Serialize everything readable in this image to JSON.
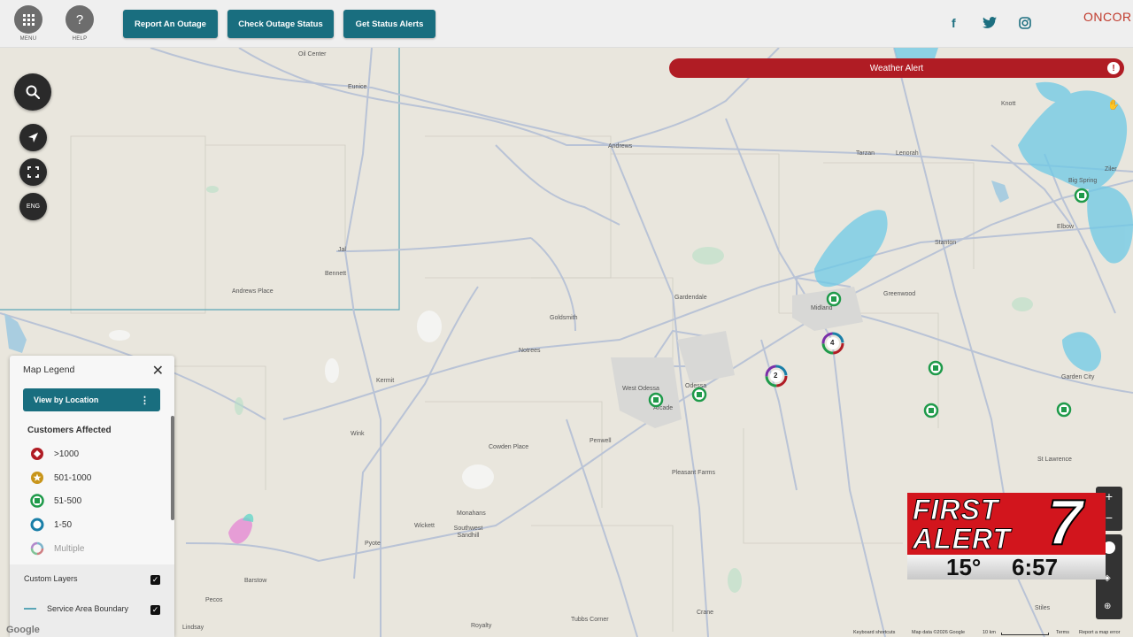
{
  "topbar": {
    "menu_label": "MENU",
    "help_label": "HELP",
    "help_icon_text": "?",
    "buttons": [
      "Report An Outage",
      "Check Outage Status",
      "Get Status Alerts"
    ],
    "social": {
      "facebook": "f",
      "twitter": "🐦",
      "instagram": "◎"
    },
    "logo_text": "ONCOR"
  },
  "weather_alert": {
    "label": "Weather Alert",
    "icon_text": "!"
  },
  "map_controls": {
    "lang_label": "ENG"
  },
  "places": [
    "Oil Center",
    "Eunice",
    "Andrews",
    "Knott",
    "Tarzan",
    "Lenorah",
    "Big Spring",
    "Elbow",
    "Stanton",
    "Jal",
    "Bennett",
    "Andrews Place",
    "Gardendale",
    "Greenwood",
    "Midland",
    "Goldsmith",
    "Notrees",
    "West Odessa",
    "Odessa",
    "Arcade",
    "Kermit",
    "Garden City",
    "Penwell",
    "Wink",
    "Cowden Place",
    "St Lawrence",
    "Pleasant Farms",
    "Monahans",
    "Wickett",
    "Southwest Sandhill",
    "Pyote",
    "Barstow",
    "Pecos",
    "Tubbs Corner",
    "Crane",
    "Stiles",
    "Lindsay",
    "Royalty",
    "Ziler"
  ],
  "clusters": [
    "4",
    "2"
  ],
  "legend": {
    "title": "Map Legend",
    "close_icon_text": "✕",
    "view_button": "View by Location",
    "view_menu_icon": "⋮",
    "section_title": "Customers Affected",
    "items": [
      ">1000",
      "501-1000",
      "51-500",
      "1-50",
      "Multiple"
    ],
    "custom_layers": "Custom Layers",
    "service_area": "Service Area Boundary"
  },
  "overlay": {
    "line1": "FIRST",
    "line2": "ALERT",
    "number": "7",
    "temp": "15°",
    "time": "6:57"
  },
  "footer": {
    "google": "Google",
    "shortcuts": "Keyboard shortcuts",
    "mapdata": "Map data ©2026 Google",
    "scale": "10 km",
    "terms": "Terms",
    "report": "Report a map error"
  },
  "colors": {
    "brand_teal": "#196e7f",
    "alert_red": "#b01c24",
    "marker_green": "#1f9a4a",
    "marker_red": "#b01c24",
    "marker_gold": "#c8951a",
    "marker_blue": "#1a7fa8"
  }
}
